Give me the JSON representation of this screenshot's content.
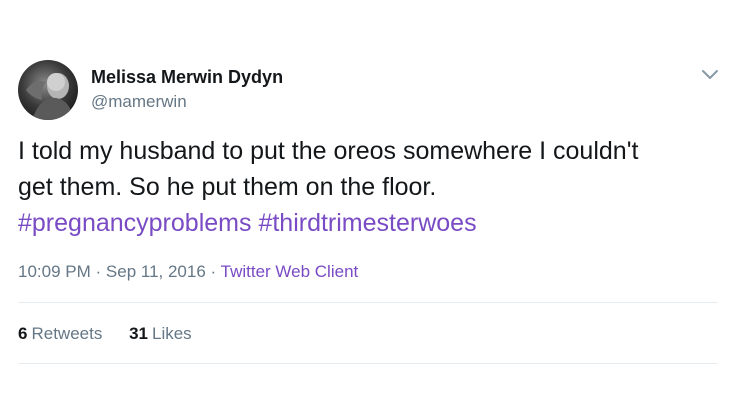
{
  "author": {
    "display_name": "Melissa Merwin Dydyn",
    "handle": "@mamerwin"
  },
  "tweet": {
    "line1": "I told my husband to put the oreos somewhere I couldn't",
    "line2": "get them.  So he put them on the floor.",
    "hashtags": [
      "#pregnancyproblems",
      "#thirdtrimesterwoes"
    ],
    "time": "10:09 PM",
    "date": "Sep 11, 2016",
    "separator": "·",
    "client": "Twitter Web Client"
  },
  "stats": {
    "retweets_count": "6",
    "retweets_label": "Retweets",
    "likes_count": "31",
    "likes_label": "Likes"
  },
  "icons": {
    "menu": "chevron-down-icon"
  },
  "colors": {
    "text": "#14171a",
    "secondary": "#657786",
    "link": "#794bc4",
    "divider": "#e6ecf0"
  }
}
